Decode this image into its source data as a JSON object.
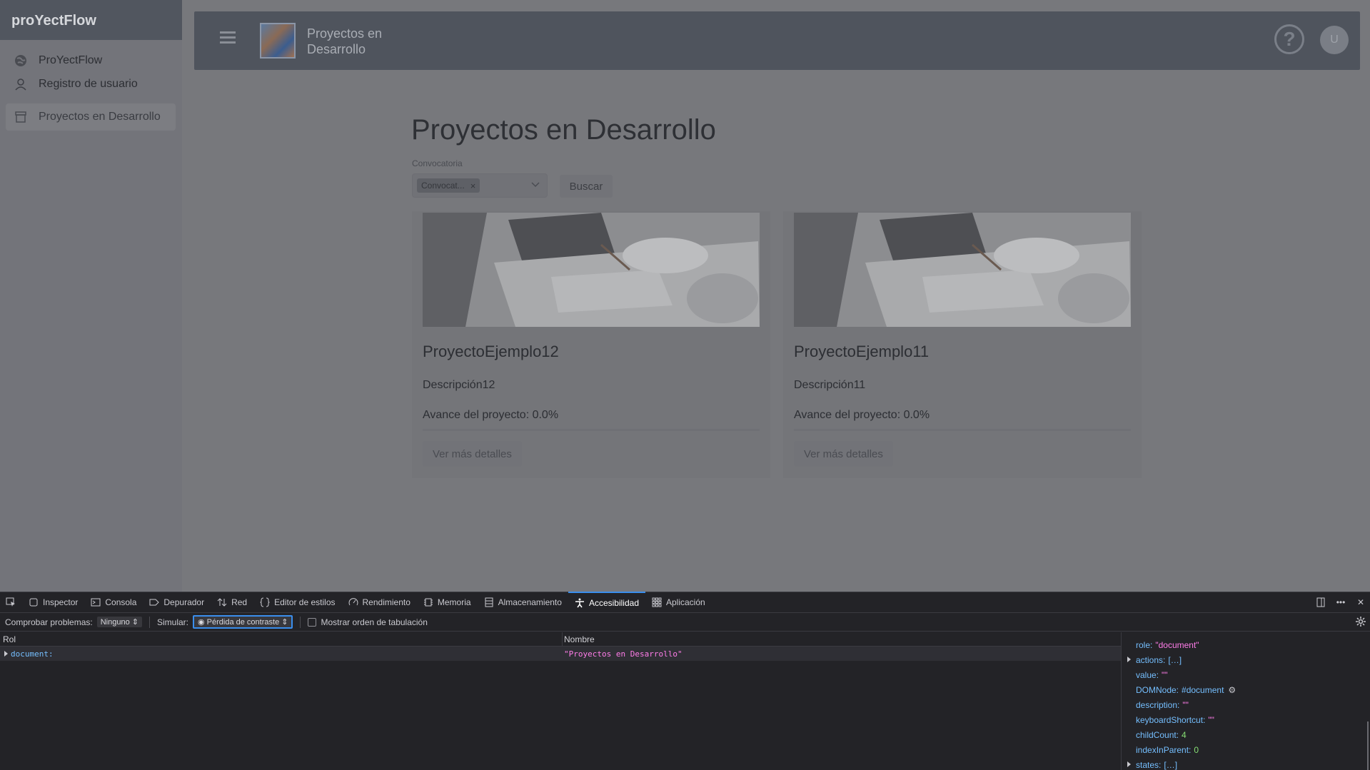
{
  "app": {
    "brand": "proYectFlow",
    "sidebar": {
      "items": [
        {
          "label": "ProYectFlow",
          "icon": "globe-icon"
        },
        {
          "label": "Registro de usuario",
          "icon": "user-icon"
        },
        {
          "label": "Proyectos en Desarrollo",
          "icon": "archive-icon",
          "active": true
        }
      ]
    },
    "topbar": {
      "title": "Proyectos en Desarrollo",
      "help": "?",
      "avatar": "U"
    },
    "page": {
      "title": "Proyectos en Desarrollo",
      "filter_label": "Convocatoria",
      "filter_chip": "Convocat...",
      "chip_close": "×",
      "search_button": "Buscar"
    },
    "projects": [
      {
        "name": "ProyectoEjemplo12",
        "description": "Descripción12",
        "progress_label": "Avance del proyecto: 0.0%",
        "progress": 0.0,
        "button": "Ver más detalles"
      },
      {
        "name": "ProyectoEjemplo11",
        "description": "Descripción11",
        "progress_label": "Avance del proyecto: 0.0%",
        "progress": 0.0,
        "button": "Ver más detalles"
      }
    ]
  },
  "devtools": {
    "tabs": [
      {
        "label": "Inspector",
        "icon": "inspector-icon"
      },
      {
        "label": "Consola",
        "icon": "console-icon"
      },
      {
        "label": "Depurador",
        "icon": "debugger-icon"
      },
      {
        "label": "Red",
        "icon": "network-icon"
      },
      {
        "label": "Editor de estilos",
        "icon": "style-editor-icon"
      },
      {
        "label": "Rendimiento",
        "icon": "performance-icon"
      },
      {
        "label": "Memoria",
        "icon": "memory-icon"
      },
      {
        "label": "Almacenamiento",
        "icon": "storage-icon"
      },
      {
        "label": "Accesibilidad",
        "icon": "accessibility-icon",
        "active": true
      },
      {
        "label": "Aplicación",
        "icon": "application-icon"
      }
    ],
    "options": {
      "check_label": "Comprobar problemas:",
      "check_value": "Ninguno",
      "simulate_label": "Simular:",
      "simulate_value": "Pérdida de contraste",
      "tab_order_label": "Mostrar orden de tabulación"
    },
    "tree": {
      "col_role": "Rol",
      "col_name": "Nombre",
      "row_role": "document:",
      "row_name": "\"Proyectos en Desarrollo\""
    },
    "props": [
      {
        "key": "role:",
        "value": "\"document\"",
        "kind": "s"
      },
      {
        "key": "actions:",
        "value": "[…]",
        "kind": "v",
        "expandable": true
      },
      {
        "key": "value:",
        "value": "\"\"",
        "kind": "s"
      },
      {
        "key": "DOMNode:",
        "value": "#document",
        "kind": "v"
      },
      {
        "key": "description:",
        "value": "\"\"",
        "kind": "s"
      },
      {
        "key": "keyboardShortcut:",
        "value": "\"\"",
        "kind": "s"
      },
      {
        "key": "childCount:",
        "value": "4",
        "kind": "n"
      },
      {
        "key": "indexInParent:",
        "value": "0",
        "kind": "n"
      },
      {
        "key": "states:",
        "value": "[…]",
        "kind": "v",
        "expandable": true
      }
    ]
  }
}
